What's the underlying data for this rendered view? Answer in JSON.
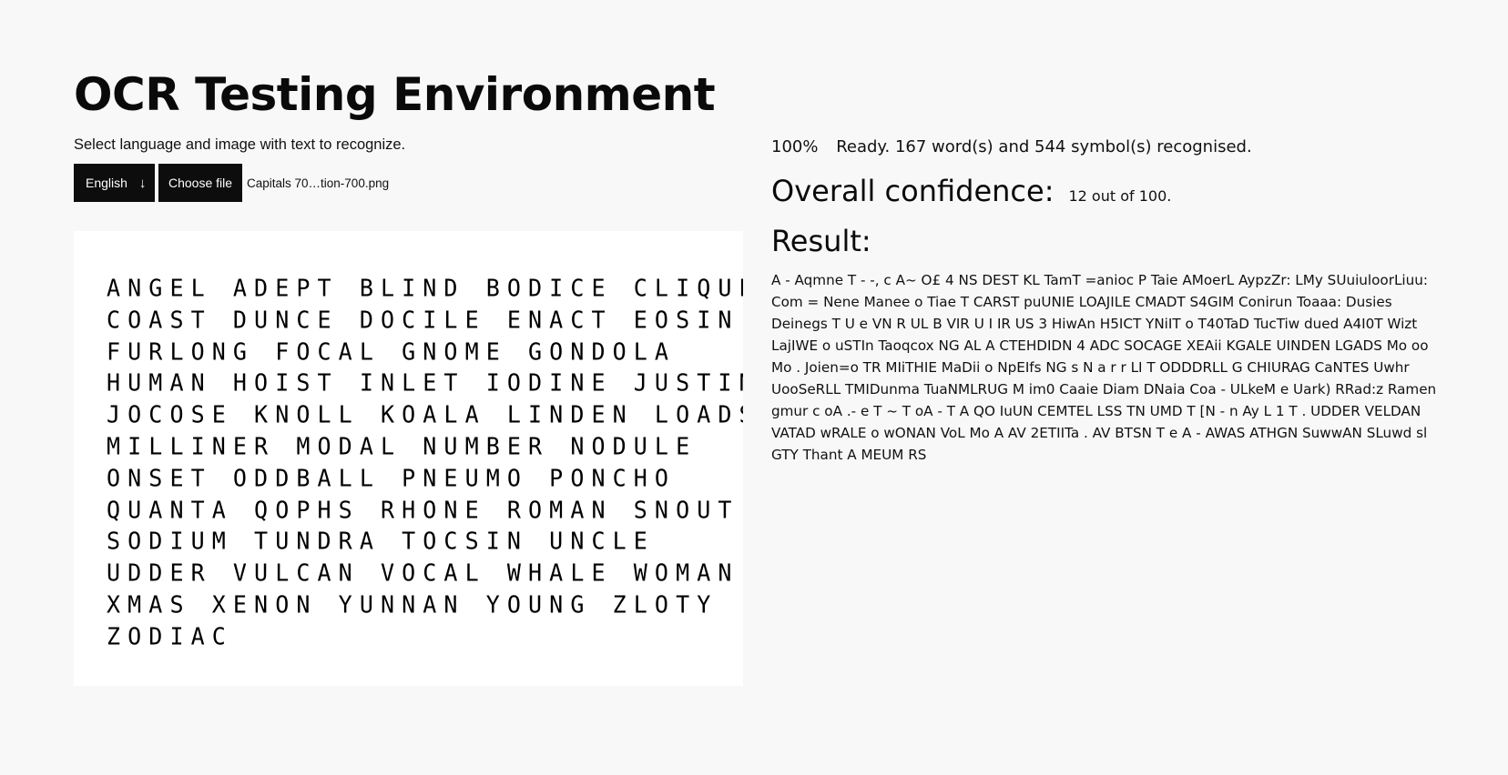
{
  "header": {
    "title": "OCR Testing Environment",
    "subtitle": "Select language and image with text to recognize."
  },
  "controls": {
    "language_selected": "English",
    "language_arrow": "↓",
    "language_arrow_icon": "arrow-down-icon",
    "choose_file_label": "Choose file",
    "file_name": "Capitals 70…tion-700.png"
  },
  "preview": {
    "lines": [
      "ANGEL ADEPT BLIND BODICE CLIQUE",
      "COAST DUNCE DOCILE ENACT EOSIN",
      "FURLONG FOCAL GNOME GONDOLA",
      "HUMAN HOIST INLET IODINE JUSTIN",
      "JOCOSE KNOLL KOALA LINDEN LOADS",
      "MILLINER MODAL NUMBER NODULE",
      "ONSET ODDBALL PNEUMO PONCHO",
      "QUANTA QOPHS RHONE ROMAN SNOUT",
      "SODIUM TUNDRA TOCSIN UNCLE",
      "UDDER VULCAN VOCAL WHALE WOMAN",
      "XMAS XENON YUNNAN YOUNG ZLOTY",
      "ZODIAC"
    ]
  },
  "status": {
    "progress": "100%",
    "message": "Ready. 167 word(s) and 544 symbol(s) recognised."
  },
  "confidence": {
    "heading": "Overall confidence:",
    "value": "12 out of 100."
  },
  "result": {
    "heading": "Result:",
    "text": "A - Aqmne T - -, c A~ O£ 4 NS DEST KL TamT =anioc P Taie AMoerL AypzZr: LMy SUuiuloorLiuu: Com = Nene Manee o Tiae T CARST puUNIE LOAJILE CMADT S4GIM Conirun Toaaa: Dusies Deinegs T U e VN R UL B VIR U I IR US 3 HiwAn H5ICT YNiIT o T40TaD TucTiw dued A4I0T Wizt LajIWE o uSTIn Taoqcox NG AL A CTEHDIDN 4 ADC SOCAGE XEAii KGALE UINDEN LGADS Mo oo Mo . Joien=o TR MIiTHIE MaDii o NpEIfs NG s N a r r LI T ODDDRLL G CHIURAG CaNTES Uwhr UooSeRLL TMIDunma TuaNMLRUG M im0 Caaie Diam DNaia Coa - ULkeM e Uark) RRad:z Ramen gmur c oA .- e T ~ T oA - T A QO IuUN CEMTEL LSS TN UMD T [N - n Ay L 1 T . UDDER VELDAN VATAD wRALE o wONAN VoL Mo A AV 2ETIITa . AV BTSN T e A - AWAS ATHGN SuwwAN SLuwd sl GTY Thant A MEUM RS"
  }
}
